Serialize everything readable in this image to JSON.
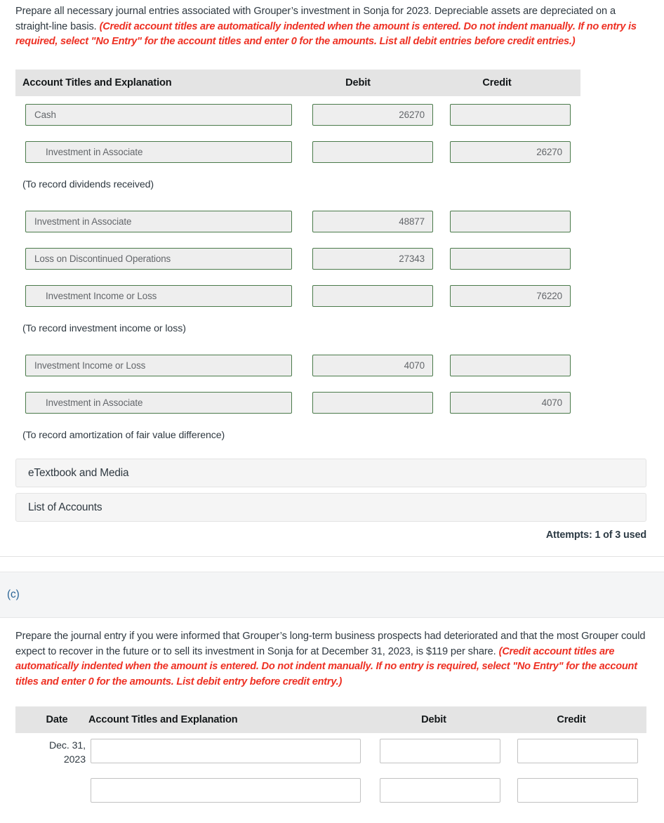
{
  "part_b": {
    "prompt_plain": "Prepare all necessary journal entries associated with Grouper’s investment in Sonja for 2023. Depreciable assets are depreciated on a straight-line basis. ",
    "prompt_red": "(Credit account titles are automatically indented when the amount is entered. Do not indent manually. If no entry is required, select \"No Entry\" for the account titles and enter 0 for the amounts. List all debit entries before credit entries.)",
    "table": {
      "headers": {
        "account": "Account Titles and Explanation",
        "debit": "Debit",
        "credit": "Credit"
      },
      "rows": [
        {
          "kind": "entry",
          "account": "Cash",
          "indent": false,
          "debit": "26270",
          "credit": ""
        },
        {
          "kind": "entry",
          "account": "Investment in Associate",
          "indent": true,
          "debit": "",
          "credit": "26270"
        },
        {
          "kind": "memo",
          "text": "(To record dividends received)"
        },
        {
          "kind": "entry",
          "account": "Investment in Associate",
          "indent": false,
          "debit": "48877",
          "credit": ""
        },
        {
          "kind": "entry",
          "account": "Loss on Discontinued Operations",
          "indent": false,
          "debit": "27343",
          "credit": ""
        },
        {
          "kind": "entry",
          "account": "Investment Income or Loss",
          "indent": true,
          "debit": "",
          "credit": "76220"
        },
        {
          "kind": "memo",
          "text": "(To record investment income or loss)"
        },
        {
          "kind": "entry",
          "account": "Investment Income or Loss",
          "indent": false,
          "debit": "4070",
          "credit": ""
        },
        {
          "kind": "entry",
          "account": "Investment in Associate",
          "indent": true,
          "debit": "",
          "credit": "4070"
        },
        {
          "kind": "memo",
          "text": "(To record amortization of fair value difference)"
        }
      ]
    },
    "etextbook_label": "eTextbook and Media",
    "accounts_label": "List of Accounts",
    "attempts": "Attempts: 1 of 3 used"
  },
  "part_c": {
    "section_label": "(c)",
    "prompt_plain": "Prepare the journal entry if you were informed that Grouper’s long-term business prospects had deteriorated and that the most Grouper could expect to recover in the future or to sell its investment in Sonja for at December 31, 2023, is $119 per share. ",
    "prompt_red": "(Credit account titles are automatically indented when the amount is entered. Do not indent manually. If no entry is required, select \"No Entry\" for the account titles and enter 0 for the amounts. List debit entry before credit entry.)",
    "table": {
      "headers": {
        "date": "Date",
        "account": "Account Titles and Explanation",
        "debit": "Debit",
        "credit": "Credit"
      },
      "rows": [
        {
          "date_line1": "Dec. 31,",
          "date_line2": "2023",
          "account": "",
          "debit": "",
          "credit": ""
        },
        {
          "date_line1": "",
          "date_line2": "",
          "account": "",
          "debit": "",
          "credit": ""
        }
      ]
    }
  },
  "colors": {
    "red_instruction": "#ee3124",
    "header_band": "#e4e4e4",
    "correct_field_border": "#4a7a4a",
    "correct_field_bg": "#eeeeee",
    "blank_field_border": "#c2c2c2",
    "section_link": "#2a6496",
    "panel_bg": "#f5f5f5"
  }
}
